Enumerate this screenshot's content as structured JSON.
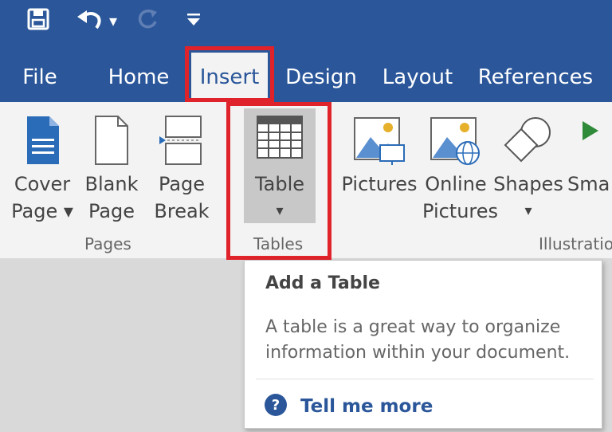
{
  "quick_access": {
    "save_icon": "save-icon",
    "undo_icon": "undo-icon",
    "undo_dropdown": "▾",
    "redo_icon": "redo-icon",
    "customize_icon": "customize-icon"
  },
  "tabs": [
    {
      "label": "File"
    },
    {
      "label": "Home"
    },
    {
      "label": "Insert",
      "active": true
    },
    {
      "label": "Design"
    },
    {
      "label": "Layout"
    },
    {
      "label": "References"
    }
  ],
  "ribbon": {
    "pages_group": {
      "label": "Pages",
      "cover_page": {
        "line1": "Cover",
        "line2": "Page ▾"
      },
      "blank_page": {
        "line1": "Blank",
        "line2": "Page"
      },
      "page_break": {
        "line1": "Page",
        "line2": "Break"
      }
    },
    "tables_group": {
      "label": "Tables",
      "table": {
        "line1": "Table",
        "line2": "▾"
      }
    },
    "illustrations_group": {
      "label": "Illustratio",
      "pictures": {
        "line1": "Pictures"
      },
      "online_pictures": {
        "line1": "Online",
        "line2": "Pictures"
      },
      "shapes": {
        "line1": "Shapes",
        "line2": "▾"
      },
      "smartart": {
        "line1": "Sma"
      }
    }
  },
  "tooltip": {
    "title": "Add a Table",
    "body": "A table is a great way to organize information within your document.",
    "link": "Tell me more",
    "link_icon": "help-icon"
  },
  "colors": {
    "title_bar": "#2b579a",
    "ribbon_bg": "#f3f3f3",
    "highlight": "#e0232b",
    "link": "#2b579a"
  }
}
